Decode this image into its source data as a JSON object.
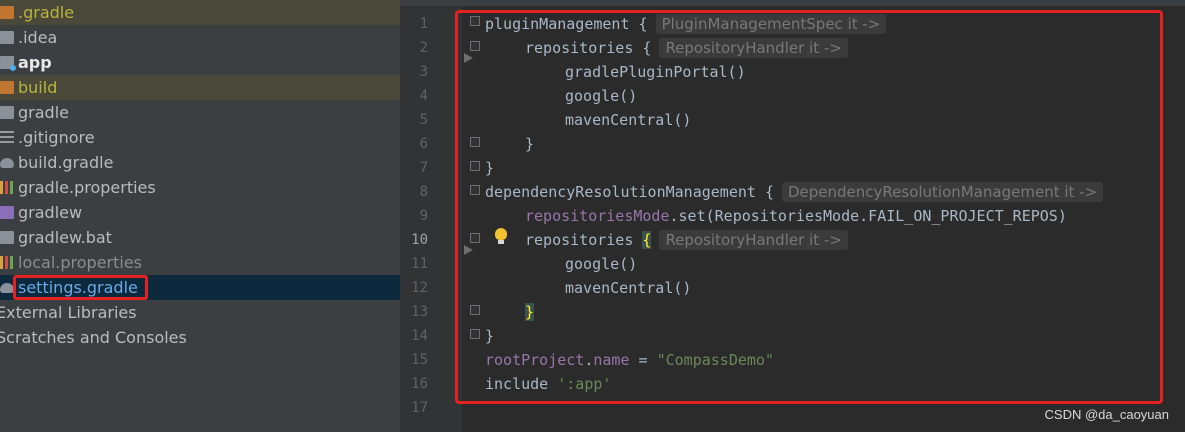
{
  "project_tree": {
    "items": [
      {
        "label": ".gradle",
        "icon": "folder-icon",
        "style": "yellow",
        "highlight": true
      },
      {
        "label": ".idea",
        "icon": "folder-icon",
        "style": "normal"
      },
      {
        "label": "app",
        "icon": "module-folder-icon",
        "style": "bold"
      },
      {
        "label": "build",
        "icon": "folder-icon",
        "style": "yellow",
        "highlight": true
      },
      {
        "label": "gradle",
        "icon": "folder-icon",
        "style": "normal"
      },
      {
        "label": ".gitignore",
        "icon": "text-file-icon",
        "style": "normal"
      },
      {
        "label": "build.gradle",
        "icon": "gradle-elephant-icon",
        "style": "normal"
      },
      {
        "label": "gradle.properties",
        "icon": "properties-file-icon",
        "style": "normal"
      },
      {
        "label": "gradlew",
        "icon": "script-file-icon",
        "style": "normal"
      },
      {
        "label": "gradlew.bat",
        "icon": "bat-file-icon",
        "style": "normal"
      },
      {
        "label": "local.properties",
        "icon": "properties-file-icon",
        "style": "dim"
      },
      {
        "label": "settings.gradle",
        "icon": "gradle-elephant-icon",
        "style": "blue",
        "selected": true
      },
      {
        "label": "External Libraries",
        "icon": "",
        "style": "normal"
      },
      {
        "label": "Scratches and Consoles",
        "icon": "",
        "style": "normal"
      }
    ]
  },
  "editor": {
    "current_line": 10,
    "line_numbers": [
      "1",
      "2",
      "3",
      "4",
      "5",
      "6",
      "7",
      "8",
      "9",
      "10",
      "11",
      "12",
      "13",
      "14",
      "15",
      "16",
      "17"
    ],
    "lines": {
      "l1": {
        "text": "pluginManagement {",
        "hint": "PluginManagementSpec it ->"
      },
      "l2": {
        "text": "repositories {",
        "hint": "RepositoryHandler it ->"
      },
      "l3": {
        "text": "gradlePluginPortal()"
      },
      "l4": {
        "text": "google()"
      },
      "l5": {
        "text": "mavenCentral()"
      },
      "l6": {
        "text": "}"
      },
      "l7": {
        "text": "}"
      },
      "l8": {
        "text": "dependencyResolutionManagement {",
        "hint": "DependencyResolutionManagement it ->"
      },
      "l9": {
        "prop": "repositoriesMode",
        "rest": ".set(RepositoriesMode.FAIL_ON_PROJECT_REPOS)"
      },
      "l10": {
        "text": "repositories ",
        "brace": "{",
        "hint": "RepositoryHandler it ->"
      },
      "l11": {
        "text": "google()"
      },
      "l12": {
        "text": "mavenCentral()"
      },
      "l13": {
        "brace": "}"
      },
      "l14": {
        "text": "}"
      },
      "l15": {
        "prop": "rootProject",
        "mid": ".",
        "prop2": "name",
        "eq": " = ",
        "str": "\"CompassDemo\""
      },
      "l16": {
        "text": "include ",
        "str": "':app'"
      }
    }
  },
  "watermark": "CSDN @da_caoyuan",
  "colors": {
    "accent_red": "#e52222",
    "string_green": "#6a8759",
    "property_purple": "#9876aa",
    "brace_yellow": "#ffef28"
  }
}
